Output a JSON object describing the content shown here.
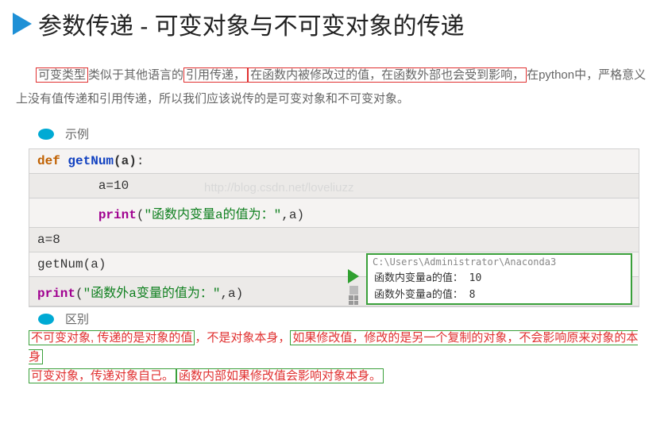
{
  "title": "参数传递 - 可变对象与不可变对象的传递",
  "intro": {
    "p1a": "可变类型",
    "p1b": "类似于其他语言的",
    "p1c": "引用传递，",
    "p1d": "在函数内被修改过的值，在函数外部也会受到影响，",
    "p1e": "在python中，严格意义上没有值传递和引用传递，所以我们应该说传的是可变对象和不可变对象。"
  },
  "bullet1": "示例",
  "bullet2": "区别",
  "code": {
    "l1_def": "def",
    "l1_name": "getNum",
    "l1_param": "(a)",
    "l1_colon": ":",
    "l2": "a=10",
    "l3_print": "print",
    "l3_str": "\"函数内变量a的值为：\"",
    "l3_tail": ",a)",
    "l4": "a=8",
    "l5": "getNum(a)",
    "l6_print": "print",
    "l6_str": "\"函数外a变量的值为：\"",
    "l6_tail": ",a)"
  },
  "watermark": "http://blog.csdn.net/loveliuzz",
  "output": {
    "path": "C:\\Users\\Administrator\\Anaconda3",
    "line1": "函数内变量a的值：  10",
    "line2": "函数外变量a的值：  8"
  },
  "diff": {
    "part1": "不可变对象, 传递的是对象的值",
    "sep1": "，不是对象本身，",
    "part2": "如果修改值，修改的是另一个复制的对象，不会影响原来对象的本身",
    "line2a": "可变对象，传递对象自己。",
    "line2b": "函数内部如果修改值会影响对象本身。"
  }
}
